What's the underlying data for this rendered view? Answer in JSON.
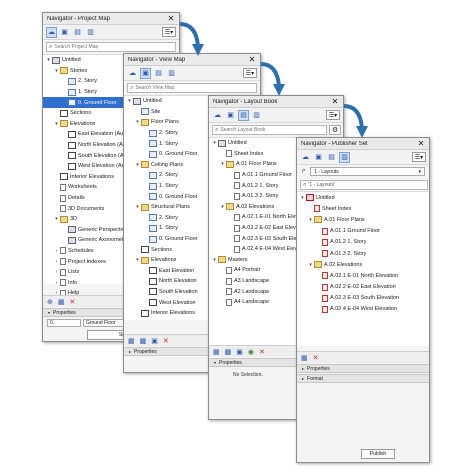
{
  "project_map": {
    "title": "Navigator - Project Map",
    "search_placeholder": "Search Project Map",
    "tree": [
      {
        "label": "Untitled",
        "depth": 0,
        "arrow": "▾",
        "icon": "cube"
      },
      {
        "label": "Stories",
        "depth": 1,
        "arrow": "▾",
        "icon": "fold"
      },
      {
        "label": "2. Story",
        "depth": 2,
        "arrow": "",
        "icon": "plan"
      },
      {
        "label": "1. Story",
        "depth": 2,
        "arrow": "",
        "icon": "plan"
      },
      {
        "label": "0. Ground Floor",
        "depth": 2,
        "arrow": "",
        "icon": "plan",
        "selected": true
      },
      {
        "label": "Sections",
        "depth": 1,
        "arrow": "",
        "icon": "elev"
      },
      {
        "label": "Elevations",
        "depth": 1,
        "arrow": "▾",
        "icon": "fold"
      },
      {
        "label": "East Elevation (Auto-re",
        "depth": 2,
        "arrow": "",
        "icon": "elev"
      },
      {
        "label": "North Elevation (Auto-",
        "depth": 2,
        "arrow": "",
        "icon": "elev"
      },
      {
        "label": "South Elevation (Auto-",
        "depth": 2,
        "arrow": "",
        "icon": "elev"
      },
      {
        "label": "West Elevation (Auto-r",
        "depth": 2,
        "arrow": "",
        "icon": "elev"
      },
      {
        "label": "Interior Elevations",
        "depth": 1,
        "arrow": "",
        "icon": "elev"
      },
      {
        "label": "Worksheets",
        "depth": 1,
        "arrow": "",
        "icon": "doc"
      },
      {
        "label": "Details",
        "depth": 1,
        "arrow": "",
        "icon": "doc"
      },
      {
        "label": "3D Documents",
        "depth": 1,
        "arrow": "",
        "icon": "doc"
      },
      {
        "label": "3D",
        "depth": 1,
        "arrow": "▾",
        "icon": "fold"
      },
      {
        "label": "Generic Perspective",
        "depth": 2,
        "arrow": "",
        "icon": "cube"
      },
      {
        "label": "Generic Axonometry",
        "depth": 2,
        "arrow": "",
        "icon": "cube"
      },
      {
        "label": "Schedules",
        "depth": 1,
        "arrow": "›",
        "icon": "doc"
      },
      {
        "label": "Project Indexes",
        "depth": 1,
        "arrow": "›",
        "icon": "doc"
      },
      {
        "label": "Lists",
        "depth": 1,
        "arrow": "›",
        "icon": "doc"
      },
      {
        "label": "Info",
        "depth": 1,
        "arrow": "›",
        "icon": "doc"
      },
      {
        "label": "Help",
        "depth": 1,
        "arrow": "›",
        "icon": "doc"
      }
    ],
    "properties_label": "Properties",
    "prop_code": "0.",
    "prop_value": "Ground Floor",
    "settings_label": "Settings..."
  },
  "view_map": {
    "title": "Navigator - View Map",
    "search_placeholder": "Search View Map",
    "tree": [
      {
        "label": "Untitled",
        "depth": 0,
        "arrow": "▾",
        "icon": "cube"
      },
      {
        "label": "Site",
        "depth": 1,
        "arrow": "",
        "icon": "plan"
      },
      {
        "label": "Floor Plans",
        "depth": 1,
        "arrow": "▾",
        "icon": "fold"
      },
      {
        "label": "2. Story",
        "depth": 2,
        "arrow": "",
        "icon": "plan"
      },
      {
        "label": "1. Story",
        "depth": 2,
        "arrow": "",
        "icon": "plan"
      },
      {
        "label": "0. Ground Floor",
        "depth": 2,
        "arrow": "",
        "icon": "plan"
      },
      {
        "label": "Ceiling Plans",
        "depth": 1,
        "arrow": "▾",
        "icon": "fold"
      },
      {
        "label": "2. Story",
        "depth": 2,
        "arrow": "",
        "icon": "plan"
      },
      {
        "label": "1. Story",
        "depth": 2,
        "arrow": "",
        "icon": "plan"
      },
      {
        "label": "0. Ground Floor",
        "depth": 2,
        "arrow": "",
        "icon": "plan"
      },
      {
        "label": "Structural Plans",
        "depth": 1,
        "arrow": "▾",
        "icon": "fold"
      },
      {
        "label": "2. Story",
        "depth": 2,
        "arrow": "",
        "icon": "plan"
      },
      {
        "label": "1. Story",
        "depth": 2,
        "arrow": "",
        "icon": "plan"
      },
      {
        "label": "0. Ground Floor",
        "depth": 2,
        "arrow": "",
        "icon": "plan"
      },
      {
        "label": "Sections",
        "depth": 1,
        "arrow": "",
        "icon": "elev"
      },
      {
        "label": "Elevations",
        "depth": 1,
        "arrow": "▾",
        "icon": "fold"
      },
      {
        "label": "East Elevation",
        "depth": 2,
        "arrow": "",
        "icon": "elev"
      },
      {
        "label": "North Elevation",
        "depth": 2,
        "arrow": "",
        "icon": "elev"
      },
      {
        "label": "South Elevation",
        "depth": 2,
        "arrow": "",
        "icon": "elev"
      },
      {
        "label": "West Elevation",
        "depth": 2,
        "arrow": "",
        "icon": "elev"
      },
      {
        "label": "Interior Elevations",
        "depth": 1,
        "arrow": "",
        "icon": "elev"
      }
    ],
    "properties_label": "Properties"
  },
  "layout_book": {
    "title": "Navigator - Layout Book",
    "search_placeholder": "Search Layout Book",
    "tree": [
      {
        "label": "Untitled",
        "depth": 0,
        "arrow": "▾",
        "icon": "cube"
      },
      {
        "label": "Sheet Index",
        "depth": 1,
        "arrow": "",
        "icon": "doc"
      },
      {
        "label": "A.01 Floor Plans",
        "depth": 1,
        "arrow": "▾",
        "icon": "fold"
      },
      {
        "label": "A.01.1 Ground Floor",
        "depth": 2,
        "arrow": "",
        "icon": "doc"
      },
      {
        "label": "A.01.2 1. Story",
        "depth": 2,
        "arrow": "",
        "icon": "doc"
      },
      {
        "label": "A.01.3 2. Story",
        "depth": 2,
        "arrow": "",
        "icon": "doc"
      },
      {
        "label": "A.02 Elevations",
        "depth": 1,
        "arrow": "▾",
        "icon": "fold"
      },
      {
        "label": "A.02.1 E-01 North Elevat",
        "depth": 2,
        "arrow": "",
        "icon": "doc"
      },
      {
        "label": "A.02.2 E-02 East Elevatio",
        "depth": 2,
        "arrow": "",
        "icon": "doc"
      },
      {
        "label": "A.02.3 E-03 South Elevati",
        "depth": 2,
        "arrow": "",
        "icon": "doc"
      },
      {
        "label": "A.02.4 E-04 West Elevatio",
        "depth": 2,
        "arrow": "",
        "icon": "doc"
      },
      {
        "label": "Masters",
        "depth": 0,
        "arrow": "▾",
        "icon": "fold"
      },
      {
        "label": "A4 Portrait",
        "depth": 1,
        "arrow": "",
        "icon": "doc"
      },
      {
        "label": "A3 Landscape",
        "depth": 1,
        "arrow": "",
        "icon": "doc"
      },
      {
        "label": "A2 Landscape",
        "depth": 1,
        "arrow": "",
        "icon": "doc"
      },
      {
        "label": "A4 Landscape",
        "depth": 1,
        "arrow": "",
        "icon": "doc"
      }
    ],
    "properties_label": "Properties",
    "no_selection": "No Selection."
  },
  "publisher_set": {
    "title": "Navigator - Publisher Set",
    "set_dropdown": "1 - Layouts",
    "search_text": "'1 - Layouts'",
    "tree": [
      {
        "label": "Untitled",
        "depth": 0,
        "arrow": "▾",
        "icon": "red"
      },
      {
        "label": "Sheet Index",
        "depth": 1,
        "arrow": "",
        "icon": "pdf"
      },
      {
        "label": "A.01 Floor Plans",
        "depth": 1,
        "arrow": "▾",
        "icon": "fold"
      },
      {
        "label": "A.01.1 Ground Floor",
        "depth": 2,
        "arrow": "",
        "icon": "pdf"
      },
      {
        "label": "A.01.2 1. Story",
        "depth": 2,
        "arrow": "",
        "icon": "pdf"
      },
      {
        "label": "A.01.3 2. Story",
        "depth": 2,
        "arrow": "",
        "icon": "pdf"
      },
      {
        "label": "A.02 Elevations",
        "depth": 1,
        "arrow": "▾",
        "icon": "fold"
      },
      {
        "label": "A.02.1 E-01 North Elevation",
        "depth": 2,
        "arrow": "",
        "icon": "pdf"
      },
      {
        "label": "A.02.2 E-02 East Elevation",
        "depth": 2,
        "arrow": "",
        "icon": "pdf"
      },
      {
        "label": "A.02.3 E-03 South Elevation",
        "depth": 2,
        "arrow": "",
        "icon": "pdf"
      },
      {
        "label": "A.02.4 E-04 West Elevation",
        "depth": 2,
        "arrow": "",
        "icon": "pdf"
      }
    ],
    "properties_label": "Properties",
    "format_label": "Format",
    "publish_label": "Publish"
  },
  "colors": {
    "selection": "#2f6fd0",
    "accent": "#2a5aa8",
    "arrow": "#2c6fad"
  }
}
